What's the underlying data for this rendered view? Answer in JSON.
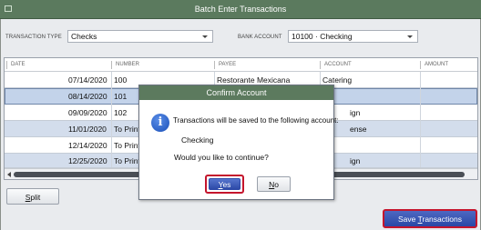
{
  "window": {
    "title": "Batch Enter Transactions"
  },
  "filters": {
    "transaction_type_label": "TRANSACTION TYPE",
    "transaction_type_value": "Checks",
    "bank_account_label": "BANK ACCOUNT",
    "bank_account_value": "10100 · Checking"
  },
  "table": {
    "headers": {
      "date": "DATE",
      "number": "NUMBER",
      "payee": "PAYEE",
      "account": "ACCOUNT",
      "amount": "AMOUNT"
    },
    "rows": [
      {
        "date": "07/14/2020",
        "number": "100",
        "payee": "Restorante Mexicana",
        "account": "Catering"
      },
      {
        "date": "08/14/2020",
        "number": "101",
        "payee": "",
        "account": ""
      },
      {
        "date": "09/09/2020",
        "number": "102",
        "payee": "",
        "account": "ign"
      },
      {
        "date": "11/01/2020",
        "number": "To Print",
        "payee": "",
        "account": "ense"
      },
      {
        "date": "12/14/2020",
        "number": "To Print",
        "payee": "",
        "account": ""
      },
      {
        "date": "12/25/2020",
        "number": "To Print",
        "payee": "",
        "account": "ign"
      }
    ]
  },
  "buttons": {
    "split_prefix": "S",
    "split_rest": "plit",
    "save_prefix": "Save ",
    "save_underlined": "T",
    "save_rest": "ransactions"
  },
  "dialog": {
    "title": "Confirm Account",
    "message_line1": "Transactions will be saved to the following account:",
    "account_name": "Checking",
    "question": "Would you like to continue?",
    "yes_underlined": "Y",
    "yes_rest": "es",
    "no_underlined": "N",
    "no_rest": "o"
  },
  "colors": {
    "title_bar": "#5b7a5e",
    "highlight_border": "#c4152d",
    "primary_button": "#2a47a6"
  },
  "icons": {
    "dialog_icon": "info-icon",
    "window_icon": "window-menu-icon"
  }
}
